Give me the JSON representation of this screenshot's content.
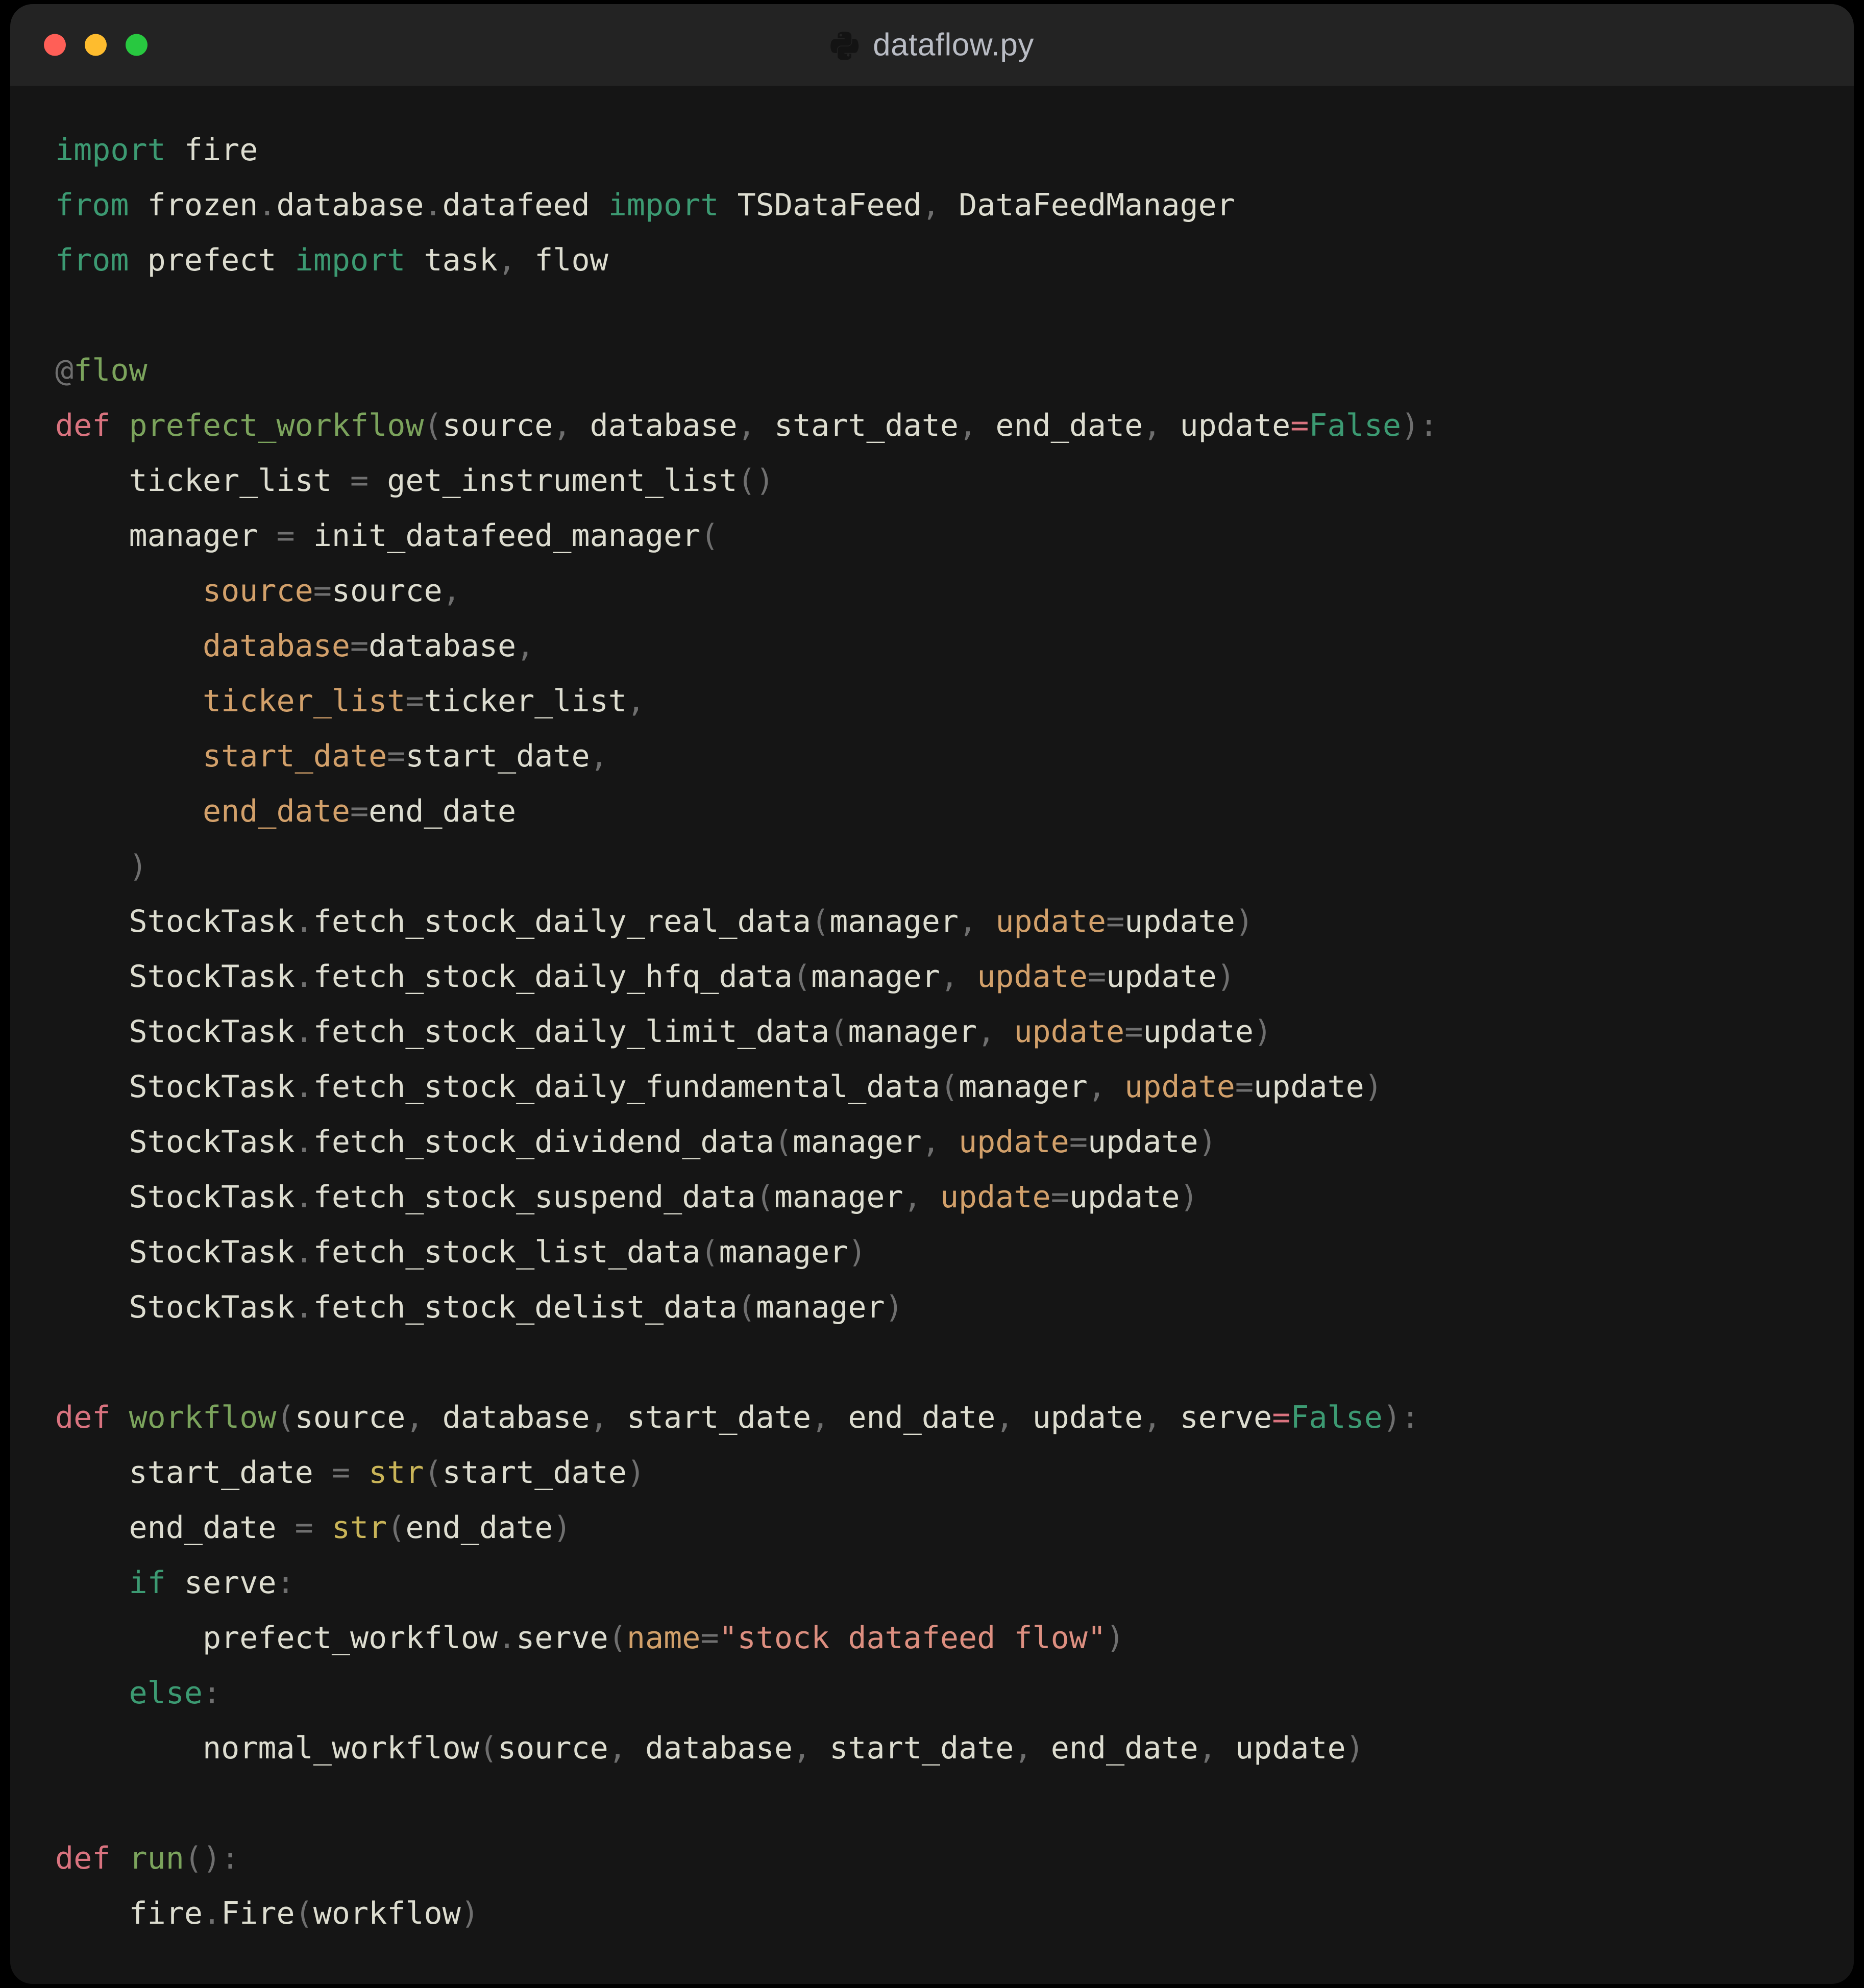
{
  "window": {
    "title": "dataflow.py",
    "icon": "python-icon",
    "controls": [
      {
        "name": "close-button",
        "color": "#ff5f57"
      },
      {
        "name": "minimize-button",
        "color": "#febc2e"
      },
      {
        "name": "maximize-button",
        "color": "#28c840"
      }
    ],
    "titlebar_bg": "#232323",
    "body_bg": "#151515"
  },
  "theme": {
    "foreground": "#ddddd0",
    "keyword": "#3c9a72",
    "def_keyword": "#d9737f",
    "function_name": "#7ba35c",
    "kwarg": "#d2a06a",
    "string": "#dd8f80",
    "builtin": "#c9b458",
    "punctuation": "#6f6f6f"
  },
  "code": {
    "language": "python",
    "filename": "dataflow.py",
    "lines": [
      "import fire",
      "from frozen.database.datafeed import TSDataFeed, DataFeedManager",
      "from prefect import task, flow",
      "",
      "@flow",
      "def prefect_workflow(source, database, start_date, end_date, update=False):",
      "    ticker_list = get_instrument_list()",
      "    manager = init_datafeed_manager(",
      "        source=source,",
      "        database=database,",
      "        ticker_list=ticker_list,",
      "        start_date=start_date,",
      "        end_date=end_date",
      "    )",
      "    StockTask.fetch_stock_daily_real_data(manager, update=update)",
      "    StockTask.fetch_stock_daily_hfq_data(manager, update=update)",
      "    StockTask.fetch_stock_daily_limit_data(manager, update=update)",
      "    StockTask.fetch_stock_daily_fundamental_data(manager, update=update)",
      "    StockTask.fetch_stock_dividend_data(manager, update=update)",
      "    StockTask.fetch_stock_suspend_data(manager, update=update)",
      "    StockTask.fetch_stock_list_data(manager)",
      "    StockTask.fetch_stock_delist_data(manager)",
      "",
      "def workflow(source, database, start_date, end_date, update, serve=False):",
      "    start_date = str(start_date)",
      "    end_date = str(end_date)",
      "    if serve:",
      "        prefect_workflow.serve(name=\"stock datafeed flow\")",
      "    else:",
      "        normal_workflow(source, database, start_date, end_date, update)",
      "",
      "def run():",
      "    fire.Fire(workflow)"
    ]
  }
}
